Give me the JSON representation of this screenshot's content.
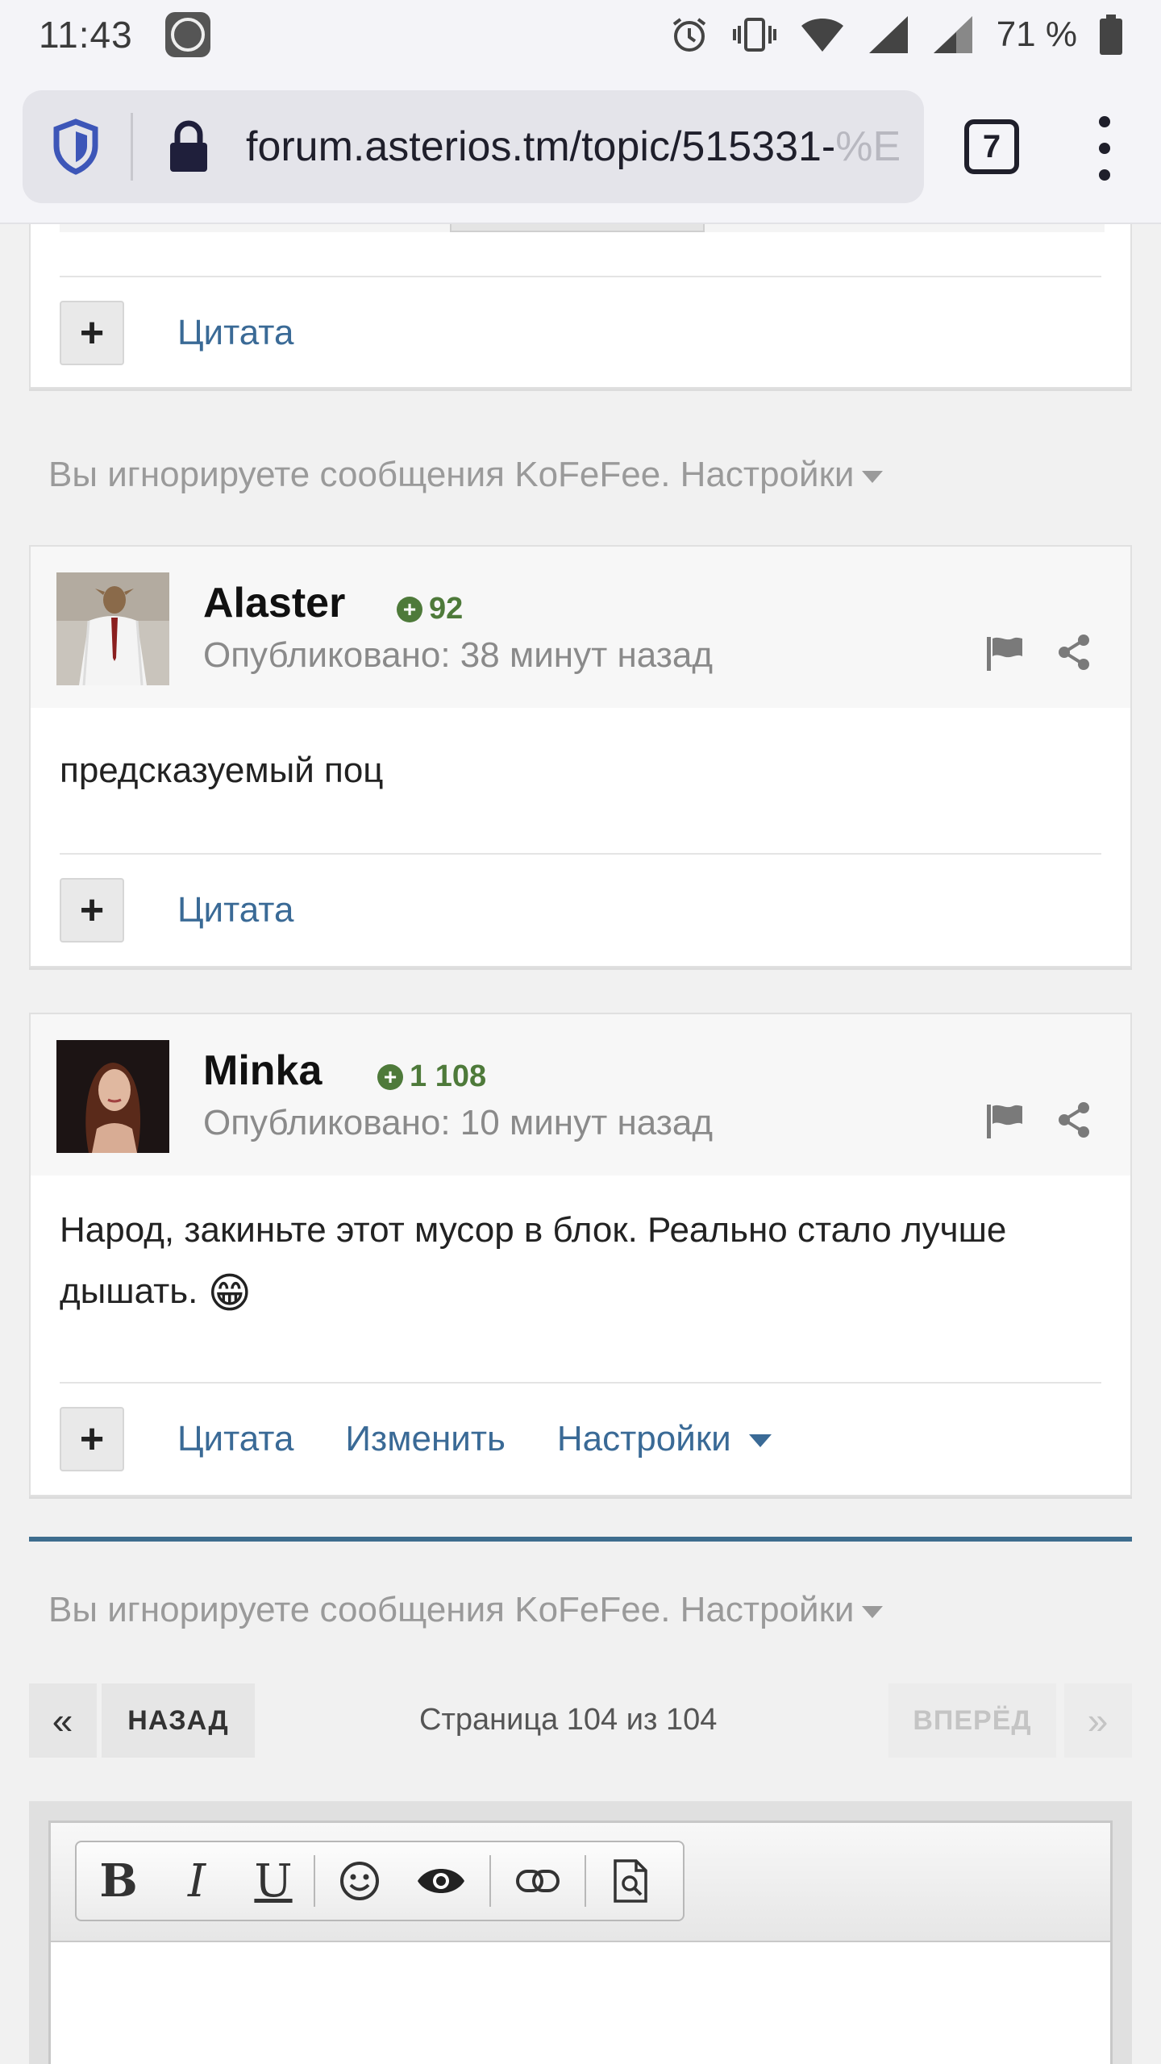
{
  "status_bar": {
    "time": "11:43",
    "battery_percent": "71 %"
  },
  "browser": {
    "url": "forum.asterios.tm/topic/515331-%E",
    "tab_count": "7"
  },
  "ignored_notice_1": {
    "text": "Вы игнорируете сообщения KoFeFee. Настройки"
  },
  "top_post": {
    "quote_label": "Цитата"
  },
  "posts": [
    {
      "author": "Alaster",
      "reputation": "92",
      "posted": "Опубликовано: 38 минут назад",
      "body": "предсказуемый поц",
      "quote_label": "Цитата"
    },
    {
      "author": "Minka",
      "reputation": "1 108",
      "posted": "Опубликовано: 10 минут назад",
      "body": "Народ, закиньте этот мусор в блок. Реально стало лучше дышать.",
      "emoji": "😁",
      "quote_label": "Цитата",
      "edit_label": "Изменить",
      "settings_label": "Настройки"
    }
  ],
  "ignored_notice_2": {
    "text": "Вы игнорируете сообщения KoFeFee. Настройки"
  },
  "pagination": {
    "first_label": "«",
    "prev_label": "НАЗАД",
    "page_label": "Страница 104 из 104",
    "next_label": "ВПЕРЁД",
    "last_label": "»"
  },
  "editor": {
    "bold": "B",
    "italic": "I",
    "underline": "U"
  },
  "colors": {
    "link": "#3a6a96",
    "reputation": "#4e7a3a",
    "divider": "#3e6d8e"
  }
}
